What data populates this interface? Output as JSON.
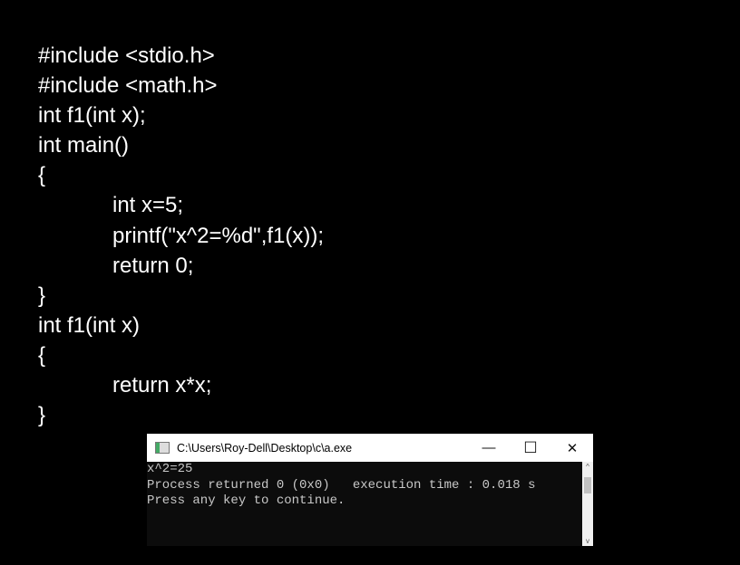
{
  "code_lines": [
    {
      "text": "#include <stdio.h>",
      "indent": false
    },
    {
      "text": "#include <math.h>",
      "indent": false
    },
    {
      "text": "int f1(int x);",
      "indent": false
    },
    {
      "text": "int main()",
      "indent": false
    },
    {
      "text": "{",
      "indent": false
    },
    {
      "text": "int x=5;",
      "indent": true
    },
    {
      "text": "printf(\"x^2=%d\",f1(x));",
      "indent": true
    },
    {
      "text": "return 0;",
      "indent": true
    },
    {
      "text": "}",
      "indent": false
    },
    {
      "text": "int f1(int x)",
      "indent": false
    },
    {
      "text": "{",
      "indent": false
    },
    {
      "text": "return x*x;",
      "indent": true
    },
    {
      "text": "}",
      "indent": false
    }
  ],
  "console": {
    "title": "C:\\Users\\Roy-Dell\\Desktop\\c\\a.exe",
    "minimize": "—",
    "maximize": "☐",
    "close": "✕",
    "output": [
      "x^2=25",
      "Process returned 0 (0x0)   execution time : 0.018 s",
      "Press any key to continue."
    ],
    "scroll_up": "^",
    "scroll_down": "v"
  }
}
